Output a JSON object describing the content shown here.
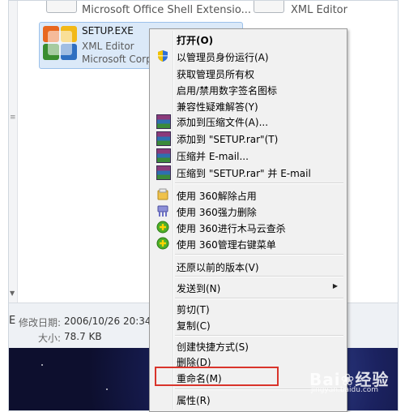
{
  "background_files": {
    "top_left": "Microsoft Office Shell Extensio...",
    "top_right": "XML Editor"
  },
  "selected_file": {
    "name": "SETUP.EXE",
    "type": "XML Editor",
    "company": "Microsoft Corp"
  },
  "status": {
    "modified_label": "修改日期:",
    "modified_value": "2006/10/26 20:34",
    "size_label": "大小:",
    "size_value": "78.7 KB",
    "prefix": "E"
  },
  "context_menu": {
    "open": "打开(O)",
    "run_as_admin": "以管理员身份运行(A)",
    "take_ownership": "获取管理员所有权",
    "toggle_signature_icon": "启用/禁用数字签名图标",
    "troubleshoot_compat": "兼容性疑难解答(Y)",
    "add_to_archive": "添加到压缩文件(A)...",
    "add_to_setup_rar": "添加到 \"SETUP.rar\"(T)",
    "compress_email": "压缩并 E-mail...",
    "compress_setup_rar_email": "压缩到 \"SETUP.rar\" 并 E-mail",
    "unlock_360": "使用 360解除占用",
    "force_delete_360": "使用 360强力删除",
    "trojan_scan_360": "使用 360进行木马云查杀",
    "manage_menu_360": "使用 360管理右键菜单",
    "restore_previous": "还原以前的版本(V)",
    "send_to": "发送到(N)",
    "cut": "剪切(T)",
    "copy": "复制(C)",
    "create_shortcut": "创建快捷方式(S)",
    "delete": "删除(D)",
    "rename": "重命名(M)",
    "properties": "属性(R)"
  },
  "watermark": {
    "brand": "Bai",
    "brand2": "经验",
    "domain": "jingyan.baidu.com"
  },
  "colors": {
    "highlight_box": "#d9342b",
    "selection": "#dbe9f8",
    "menu_bg": "#f1f1f1"
  }
}
